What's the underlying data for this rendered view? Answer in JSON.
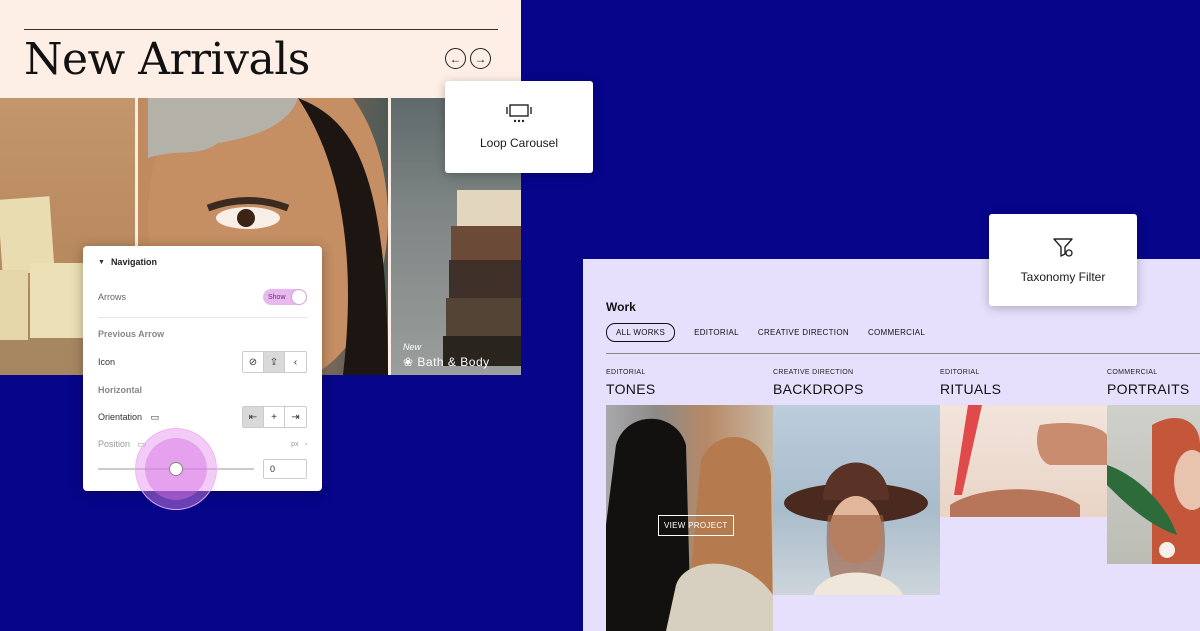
{
  "new_arrivals": {
    "title": "New Arrivals",
    "prev_icon": "arrow-left-icon",
    "next_icon": "arrow-right-icon",
    "tile_badge": "New",
    "tile_name": "Bath & Body"
  },
  "loop_carousel_card": {
    "label": "Loop Carousel",
    "icon": "carousel-icon"
  },
  "taxonomy_filter_card": {
    "label": "Taxonomy Filter",
    "icon": "filter-icon"
  },
  "navigation_panel": {
    "section_title": "Navigation",
    "arrows_label": "Arrows",
    "arrows_toggle": "Show",
    "previous_arrow_label": "Previous Arrow",
    "icon_label": "Icon",
    "horizontal_label": "Horizontal",
    "orientation_label": "Orientation",
    "position_label": "Position",
    "position_unit": "px",
    "position_value": "0",
    "position_slider_fraction": 0.5
  },
  "work_panel": {
    "title": "Work",
    "filters": [
      "ALL WORKS",
      "EDITORIAL",
      "CREATIVE DIRECTION",
      "COMMERCIAL"
    ],
    "active_filter": "ALL WORKS",
    "projects": [
      {
        "category": "EDITORIAL",
        "name": "TONES"
      },
      {
        "category": "CREATIVE DIRECTION",
        "name": "BACKDROPS"
      },
      {
        "category": "EDITORIAL",
        "name": "RITUALS"
      },
      {
        "category": "COMMERCIAL",
        "name": "PORTRAITS"
      }
    ],
    "view_project_label": "VIEW PROJECT"
  },
  "colors": {
    "background": "#07058a",
    "new_arrivals_bg": "#fdefe6",
    "work_bg": "#e6e0fc",
    "toggle_accent": "#e9b8ee"
  }
}
